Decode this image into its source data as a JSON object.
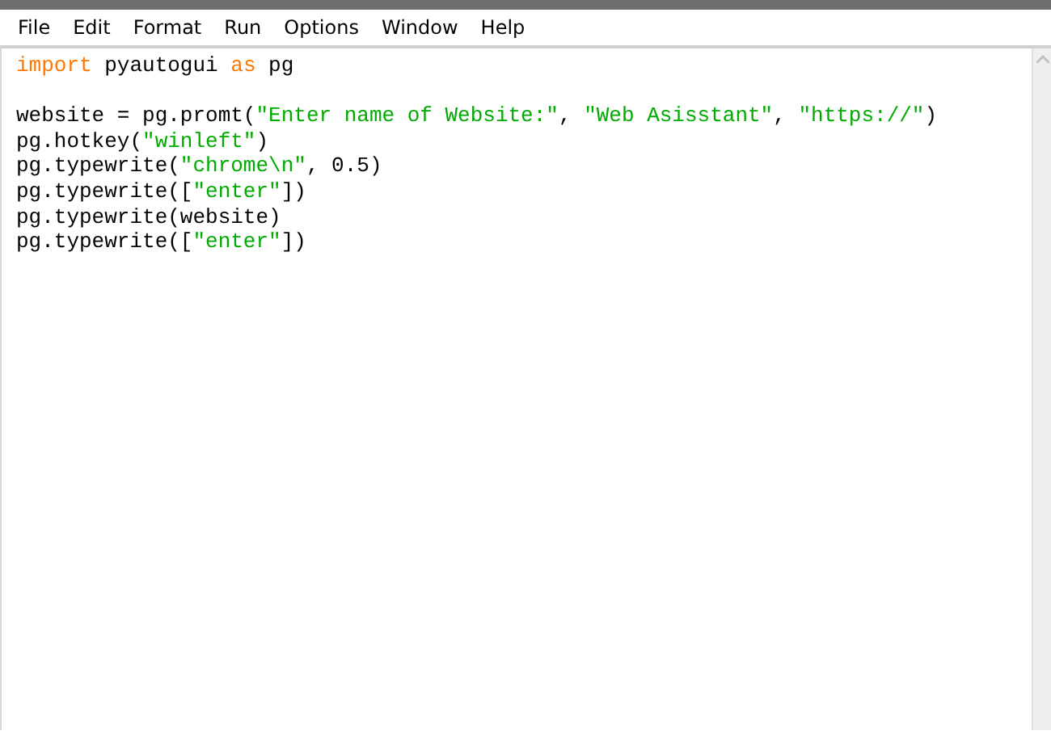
{
  "menu": [
    {
      "label": "File"
    },
    {
      "label": "Edit"
    },
    {
      "label": "Format"
    },
    {
      "label": "Run"
    },
    {
      "label": "Options"
    },
    {
      "label": "Window"
    },
    {
      "label": "Help"
    }
  ],
  "editor": {
    "lines": [
      {
        "kind": "code",
        "tokens": [
          {
            "kind": "keyword",
            "text": "import"
          },
          {
            "kind": "plain",
            "text": " pyautogui "
          },
          {
            "kind": "keyword",
            "text": "as"
          },
          {
            "kind": "plain",
            "text": " pg"
          }
        ]
      },
      {
        "kind": "blank"
      },
      {
        "kind": "code",
        "tokens": [
          {
            "kind": "plain",
            "text": "website = pg.promt("
          },
          {
            "kind": "string",
            "text": "\"Enter name of Website:\""
          },
          {
            "kind": "plain",
            "text": ", "
          },
          {
            "kind": "string",
            "text": "\"Web Asisstant\""
          },
          {
            "kind": "plain",
            "text": ", "
          },
          {
            "kind": "string",
            "text": "\"https://\""
          },
          {
            "kind": "plain",
            "text": ")"
          }
        ]
      },
      {
        "kind": "code",
        "tokens": [
          {
            "kind": "plain",
            "text": "pg.hotkey("
          },
          {
            "kind": "string",
            "text": "\"winleft\""
          },
          {
            "kind": "plain",
            "text": ")"
          }
        ]
      },
      {
        "kind": "code",
        "tokens": [
          {
            "kind": "plain",
            "text": "pg.typewrite("
          },
          {
            "kind": "string",
            "text": "\"chrome\\n\""
          },
          {
            "kind": "plain",
            "text": ", 0.5)"
          }
        ]
      },
      {
        "kind": "code",
        "tokens": [
          {
            "kind": "plain",
            "text": "pg.typewrite(["
          },
          {
            "kind": "string",
            "text": "\"enter\""
          },
          {
            "kind": "plain",
            "text": "])"
          }
        ]
      },
      {
        "kind": "code",
        "tokens": [
          {
            "kind": "plain",
            "text": "pg.typewrite(website)"
          }
        ]
      },
      {
        "kind": "code",
        "tokens": [
          {
            "kind": "plain",
            "text": "pg.typewrite(["
          },
          {
            "kind": "string",
            "text": "\"enter\""
          },
          {
            "kind": "plain",
            "text": "])"
          }
        ]
      }
    ]
  }
}
